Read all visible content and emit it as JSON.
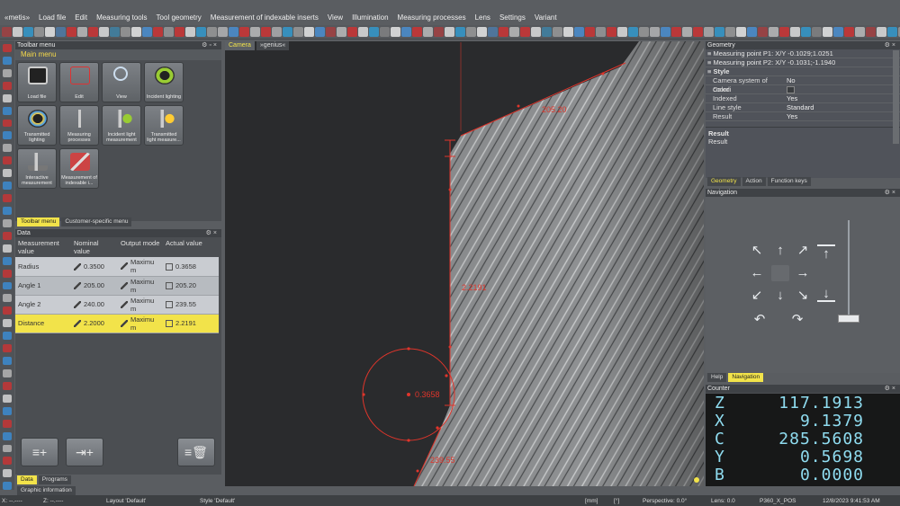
{
  "app": {
    "logo": "«metis»"
  },
  "menu": [
    "Load file",
    "Edit",
    "Measuring tools",
    "Tool geometry",
    "Measurement of indexable inserts",
    "View",
    "Illumination",
    "Measuring processes",
    "Lens",
    "Settings",
    "Variant"
  ],
  "toolbar_menu": {
    "title": "Toolbar menu",
    "main_label": "Main menu",
    "tiles": [
      {
        "label": "Load file",
        "icon": "floppy-disk-icon"
      },
      {
        "label": "Edit",
        "icon": "edit-shape-icon"
      },
      {
        "label": "View",
        "icon": "magnifier-icon"
      },
      {
        "label": "Incident lighting",
        "icon": "ring-light-icon"
      },
      {
        "label": "Transmitted lighting",
        "icon": "ring-light-colored-icon"
      },
      {
        "label": "Measuring processes",
        "icon": "caliper-icon"
      },
      {
        "label": "Incident light measurement",
        "icon": "caliper-light-icon"
      },
      {
        "label": "Transmitted light measure...",
        "icon": "caliper-transmitted-icon"
      },
      {
        "label": "Interactive measurement",
        "icon": "interactive-caliper-icon"
      },
      {
        "label": "Measurement of indexable i...",
        "icon": "indexable-insert-icon"
      }
    ],
    "tabs": [
      "Toolbar menu",
      "Customer-specific menu"
    ]
  },
  "data_panel": {
    "title": "Data",
    "headers": [
      "Measurement value",
      "Nominal value",
      "Output mode",
      "Actual value"
    ],
    "rows": [
      {
        "name": "Radius",
        "nominal": "0.3500",
        "mode": "Maximu m",
        "actual": "0.3658"
      },
      {
        "name": "Angle 1",
        "nominal": "205.00",
        "mode": "Maximu m",
        "actual": "205.20"
      },
      {
        "name": "Angle 2",
        "nominal": "240.00",
        "mode": "Maximu m",
        "actual": "239.55"
      },
      {
        "name": "Distance",
        "nominal": "2.2000",
        "mode": "Maximu m",
        "actual": "2.2191"
      }
    ],
    "tabs": [
      "Data",
      "Programs",
      "Graphic information"
    ]
  },
  "camera": {
    "tabs": [
      "Camera",
      "»genius«"
    ],
    "annotations": {
      "angle1": "205.20",
      "distance": "2.2191",
      "radius": "0.3658",
      "angle2": "239.55"
    }
  },
  "geometry": {
    "title": "Geometry",
    "points": [
      "Measuring point P1: X/Y  -0.1029;1.0251",
      "Measuring point P2: X/Y  -0.1031;-1.1940"
    ],
    "style_label": "Style",
    "props": [
      {
        "k": "Camera system of coordi",
        "v": "No"
      },
      {
        "k": "Color",
        "v": ""
      },
      {
        "k": "Indexed",
        "v": "Yes"
      },
      {
        "k": "Line style",
        "v": "Standard"
      },
      {
        "k": "Result",
        "v": "Yes"
      }
    ],
    "result_title": "Result",
    "result_text": "Result",
    "tabs": [
      "Geometry",
      "Action",
      "Function keys"
    ]
  },
  "navigation": {
    "title": "Navigation",
    "tabs": [
      "Help",
      "Navigation"
    ]
  },
  "counter": {
    "title": "Counter",
    "rows": [
      {
        "axis": "Z",
        "value": "117.1913"
      },
      {
        "axis": "X",
        "value": "9.1379"
      },
      {
        "axis": "C",
        "value": "285.5608"
      },
      {
        "axis": "Y",
        "value": "0.5698"
      },
      {
        "axis": "B",
        "value": "0.0000"
      }
    ]
  },
  "status": {
    "x": "X: --.----",
    "z": "Z: --.----",
    "layout": "Layout 'Default'",
    "style": "Style 'Default'",
    "unit": "[mm]",
    "deg": "[°]",
    "perspective": "Perspective: 0.0°",
    "lens": "Lens: 0.0",
    "pos": "P360_X_POS",
    "datetime": "12/8/2023 9:41:53 AM"
  },
  "colors": {
    "accent": "#f2e34a",
    "measure_red": "#e0352b",
    "counter_text": "#8fdcf0"
  }
}
